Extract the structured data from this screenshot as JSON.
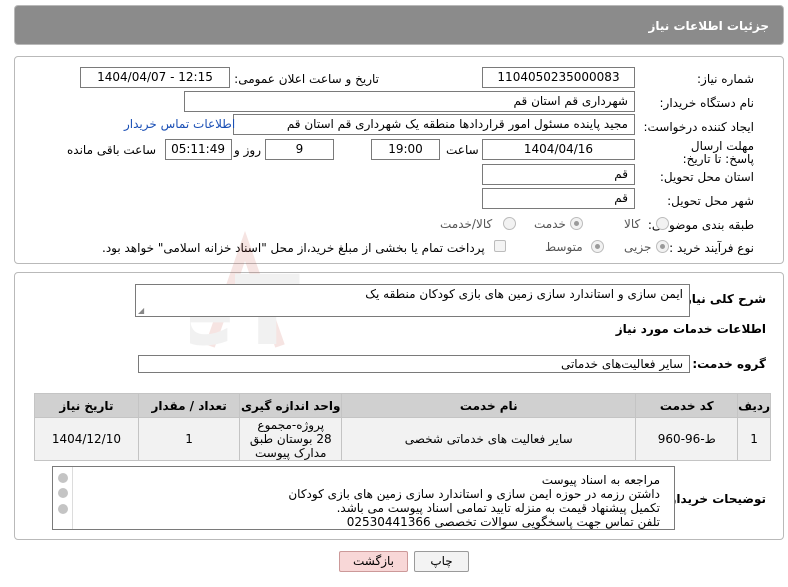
{
  "header": {
    "title": "جزئیات اطلاعات نیاز"
  },
  "form": {
    "need_number_label": "شماره نیاز:",
    "need_number": "1104050235000083",
    "announce_label": "تاریخ و ساعت اعلان عمومی:",
    "announce_value": "1404/04/07 - 12:15",
    "buyer_org_label": "نام دستگاه خریدار:",
    "buyer_org": "شهرداری قم استان قم",
    "creator_label": "ایجاد کننده درخواست:",
    "creator": "مجید پاینده مسئول امور قراردادها منطقه یک شهرداری قم استان قم",
    "contact_link": "اطلاعات تماس خریدار",
    "deadline_label": "مهلت ارسال پاسخ: تا تاریخ:",
    "deadline_date": "1404/04/16",
    "time_label": "ساعت",
    "deadline_time": "19:00",
    "days_value": "9",
    "days_label": "روز و",
    "remaining_time": "05:11:49",
    "remaining_label": "ساعت باقی مانده",
    "province_label": "استان محل تحویل:",
    "province": "قم",
    "city_label": "شهر محل تحویل:",
    "city": "قم",
    "category_label": "طبقه بندی موضوعی:",
    "category_options": [
      "کالا",
      "خدمت",
      "کالا/خدمت"
    ],
    "category_selected": "خدمت",
    "process_label": "نوع فرآیند خرید :",
    "process_options": [
      "جزیی",
      "متوسط"
    ],
    "process_selected": "جزیی",
    "payment_note": "پرداخت تمام یا بخشی از مبلغ خرید،از محل \"اسناد خزانه اسلامی\" خواهد بود."
  },
  "details": {
    "summary_label": "شرح کلی نیاز:",
    "summary": "ایمن سازی و استاندارد سازی زمین های بازی کودکان منطقه یک",
    "services_heading": "اطلاعات خدمات مورد نیاز",
    "service_group_label": "گروه خدمت:",
    "service_group": "سایر فعالیت‌های خدماتی",
    "table": {
      "headers": [
        "ردیف",
        "کد خدمت",
        "نام خدمت",
        "واحد اندازه گیری",
        "تعداد / مقدار",
        "تاریخ نیاز"
      ],
      "rows": [
        [
          "1",
          "ط-96-960",
          "سایر فعالیت های خدماتی شخصی",
          "پروژه-مجموع 28 بوستان طبق مدارک پیوست",
          "1",
          "1404/12/10"
        ]
      ]
    },
    "buyer_notes_label": "توضیحات خریدار:",
    "buyer_notes": [
      "مراجعه به اسناد پیوست",
      "داشتن رزمه در حوزه ایمن سازی و استاندارد سازی زمین های بازی کودکان",
      "تکمیل پیشنهاد قیمت به منزله تایید تمامی اسناد پیوست می باشد.",
      "تلفن تماس جهت پاسخگویی سوالات تخصصی 02530441366"
    ]
  },
  "buttons": {
    "print": "چاپ",
    "back": "بازگشت"
  },
  "watermark": {
    "text": "AriaTender.neT",
    "color": "#c0392b"
  }
}
